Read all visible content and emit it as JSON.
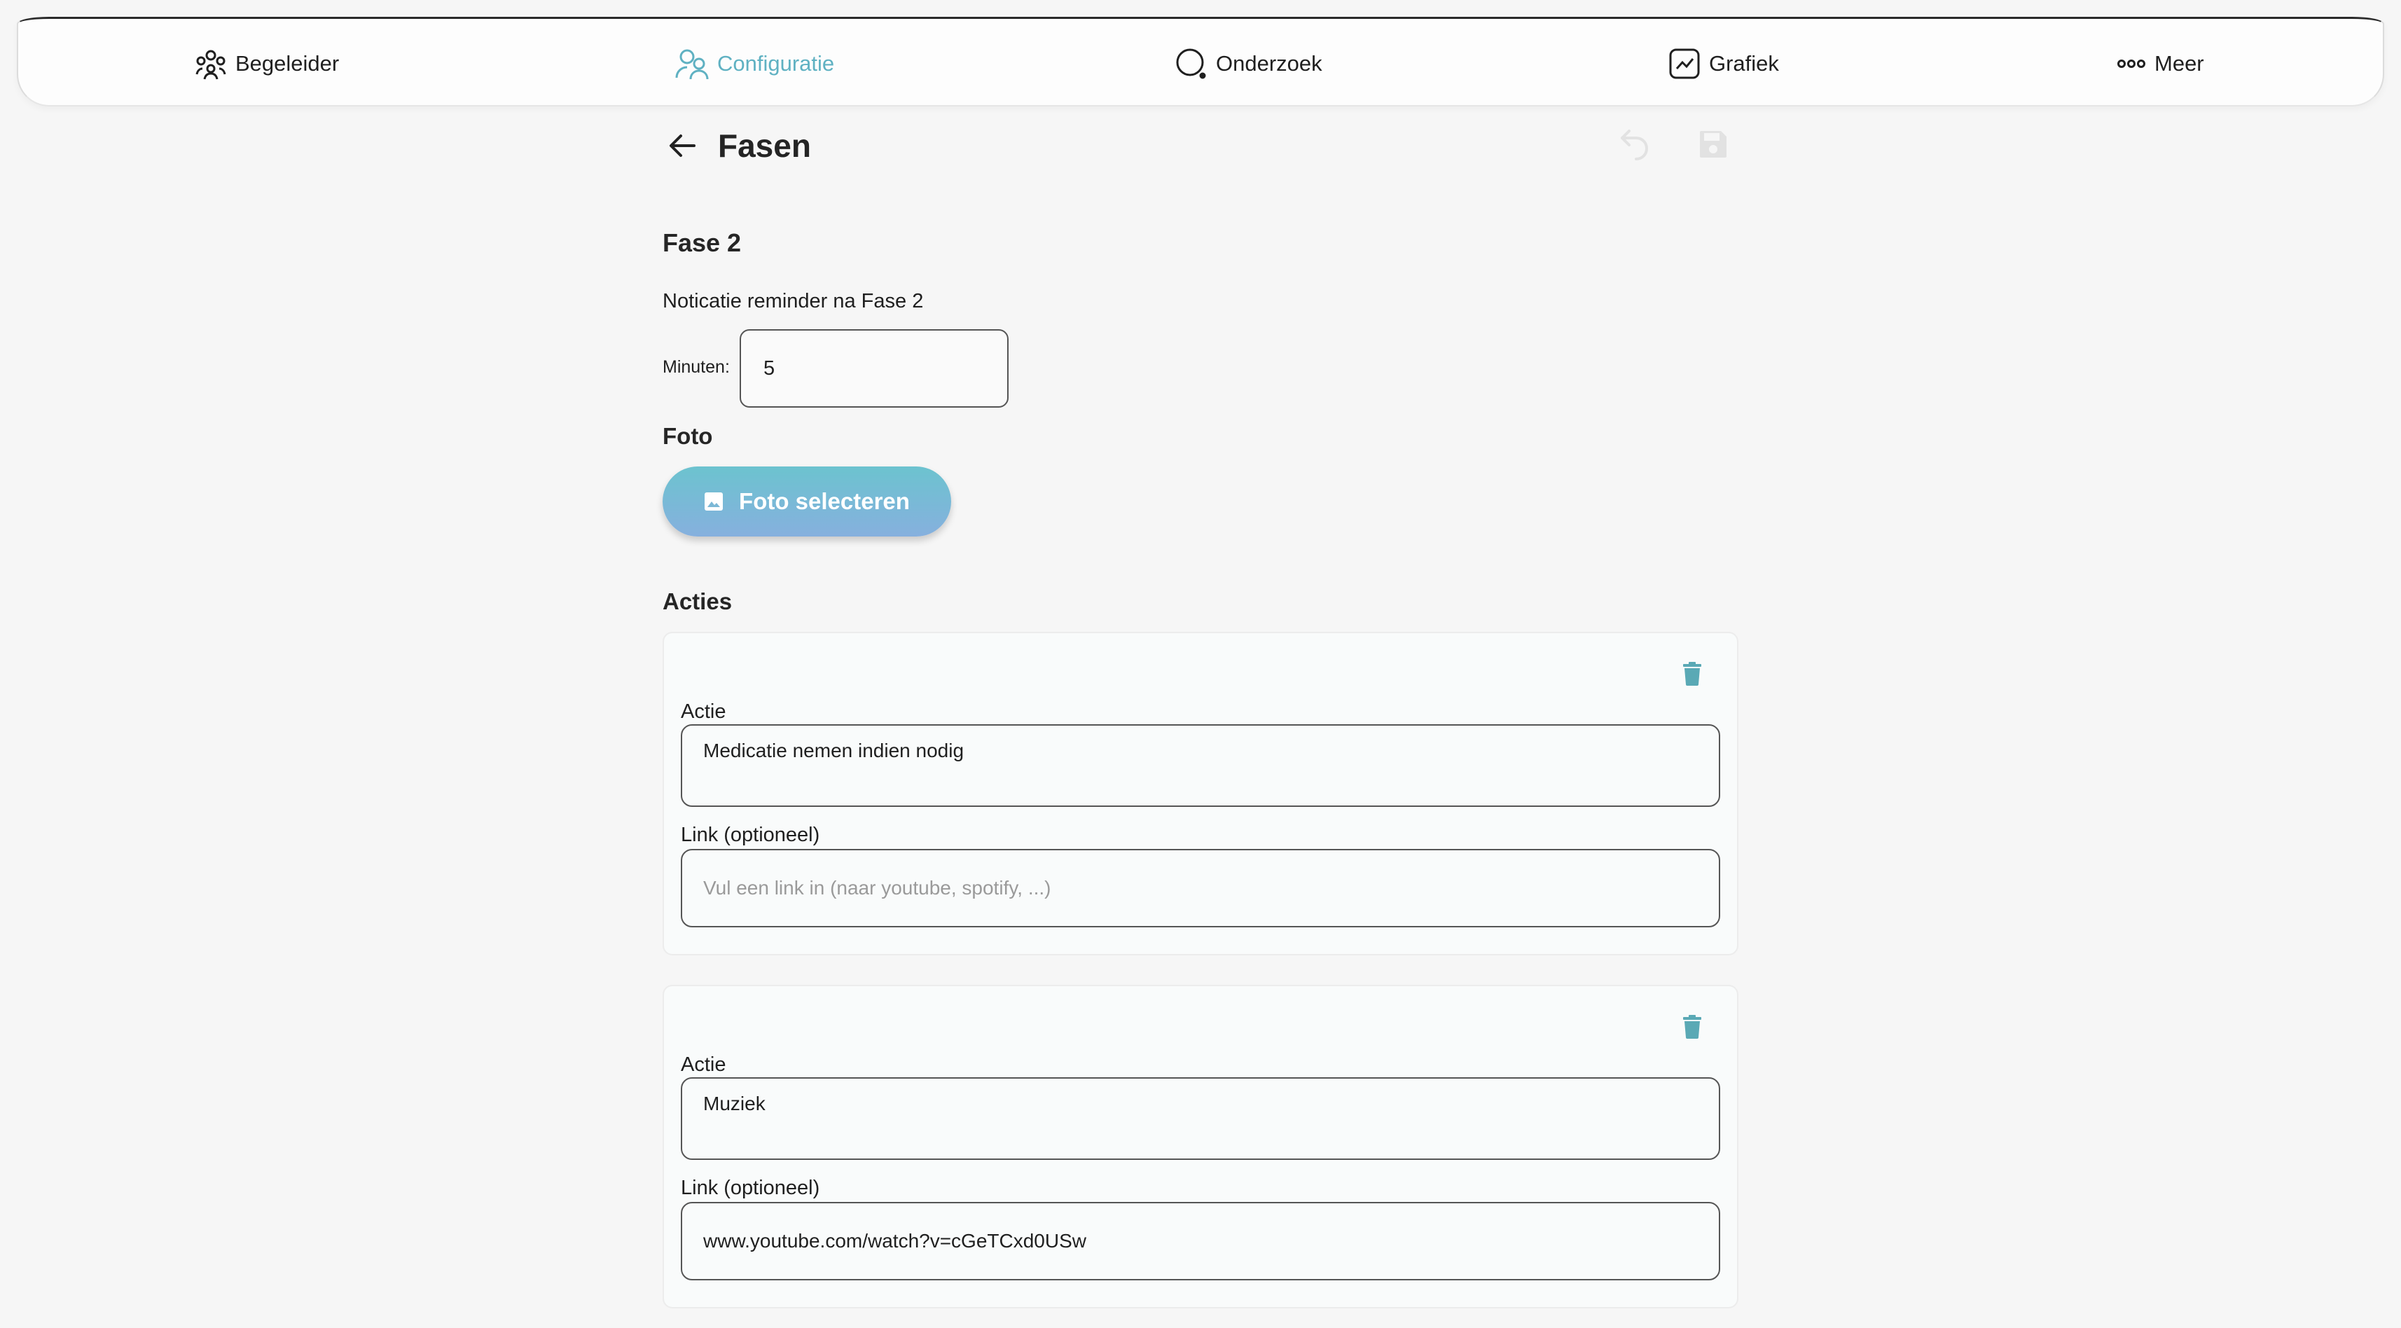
{
  "nav": {
    "items": [
      {
        "label": "Begeleider",
        "icon": "people-group-icon"
      },
      {
        "label": "Configuratie",
        "icon": "users-config-icon",
        "active": true
      },
      {
        "label": "Onderzoek",
        "icon": "search-circle-icon"
      },
      {
        "label": "Grafiek",
        "icon": "chart-icon"
      },
      {
        "label": "Meer",
        "icon": "more-dots-icon"
      }
    ]
  },
  "header": {
    "title": "Fasen"
  },
  "phase": {
    "title": "Fase 2",
    "reminder_label": "Noticatie reminder na Fase 2",
    "minutes_label": "Minuten:",
    "minutes_value": "5"
  },
  "photo": {
    "title": "Foto",
    "button_label": "Foto selecteren"
  },
  "actions": {
    "title": "Acties",
    "items": [
      {
        "actie_label": "Actie",
        "actie_value": "Medicatie nemen indien nodig",
        "link_label": "Link (optioneel)",
        "link_value": "",
        "link_placeholder": "Vul een link in (naar youtube, spotify, ...)"
      },
      {
        "actie_label": "Actie",
        "actie_value": "Muziek",
        "link_label": "Link (optioneel)",
        "link_value": "www.youtube.com/watch?v=cGeTCxd0USw",
        "link_placeholder": "Vul een link in (naar youtube, spotify, ...)"
      }
    ]
  },
  "colors": {
    "accent": "#5fb1c2",
    "trash": "#5aa9b5",
    "disabled_icon": "#e2e2e2"
  }
}
